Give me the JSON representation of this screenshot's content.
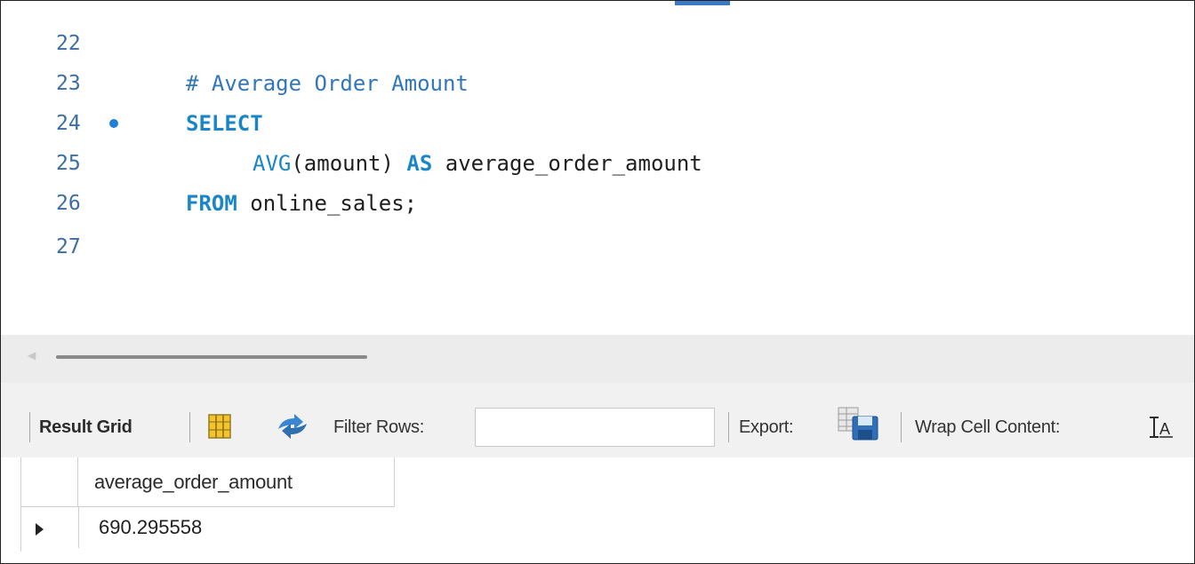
{
  "editor": {
    "lines": [
      {
        "number": "22",
        "text": ""
      },
      {
        "number": "23",
        "text": "# Average Order Amount"
      },
      {
        "number": "24",
        "text": "SELECT"
      },
      {
        "number": "25",
        "fn": "AVG",
        "args": "(amount) ",
        "kw": "AS",
        "rest": " average_order_amount"
      },
      {
        "number": "26",
        "kw": "FROM",
        "rest": " online_sales;"
      },
      {
        "number": "27",
        "text": ""
      }
    ]
  },
  "toolbar": {
    "result_grid_label": "Result Grid",
    "filter_rows_label": "Filter Rows:",
    "filter_rows_value": "",
    "export_label": "Export:",
    "wrap_cell_label": "Wrap Cell Content:"
  },
  "grid": {
    "columns": [
      "average_order_amount"
    ],
    "rows": [
      [
        "690.295558"
      ]
    ]
  },
  "icons": {
    "grid_layout": "grid-layout-icon",
    "refresh": "refresh-icon",
    "export": "export-icon",
    "wrap": "wrap-text-icon"
  },
  "colors": {
    "keyword": "#1a86c8",
    "comment": "#3377bb",
    "line_number": "#3a6ea5",
    "breakpoint": "#1f7fdc"
  }
}
